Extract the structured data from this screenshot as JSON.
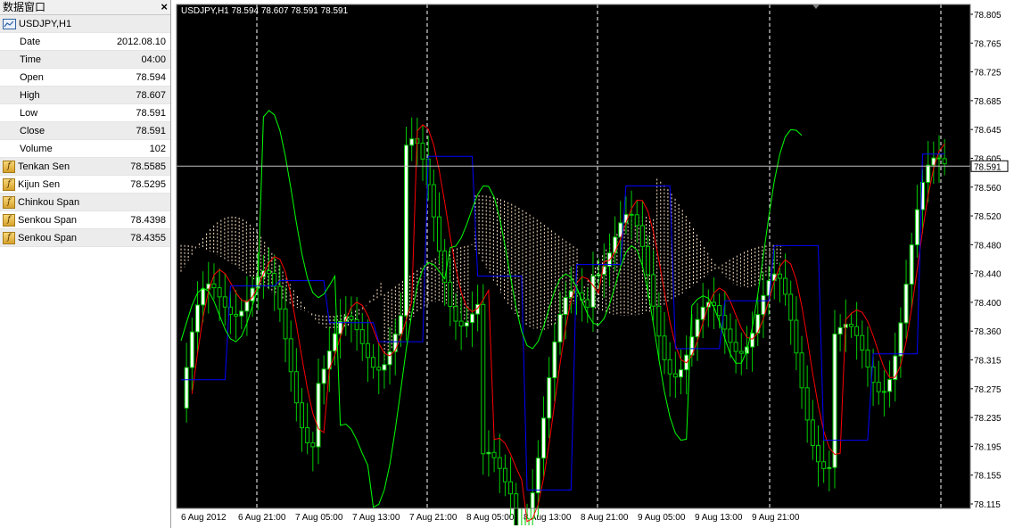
{
  "data_window": {
    "title": "数据窗口",
    "symbol": "USDJPY,H1",
    "rows": [
      {
        "label": "Date",
        "value": "2012.08.10",
        "indicator": false
      },
      {
        "label": "Time",
        "value": "04:00",
        "indicator": false
      },
      {
        "label": "Open",
        "value": "78.594",
        "indicator": false
      },
      {
        "label": "High",
        "value": "78.607",
        "indicator": false
      },
      {
        "label": "Low",
        "value": "78.591",
        "indicator": false
      },
      {
        "label": "Close",
        "value": "78.591",
        "indicator": false
      },
      {
        "label": "Volume",
        "value": "102",
        "indicator": false
      },
      {
        "label": "Tenkan Sen",
        "value": "78.5585",
        "indicator": true
      },
      {
        "label": "Kijun Sen",
        "value": "78.5295",
        "indicator": true
      },
      {
        "label": "Chinkou Span",
        "value": "",
        "indicator": true
      },
      {
        "label": "Senkou Span",
        "value": "78.4398",
        "indicator": true
      },
      {
        "label": "Senkou Span",
        "value": "78.4355",
        "indicator": true
      }
    ]
  },
  "chart": {
    "header": "USDJPY,H1  78.594 78.607 78.591 78.591",
    "current_price": "78.591",
    "price_axis": [
      "78.805",
      "78.765",
      "78.725",
      "78.685",
      "78.645",
      "78.605",
      "78.560",
      "78.520",
      "78.480",
      "78.440",
      "78.400",
      "78.360",
      "78.315",
      "78.275",
      "78.235",
      "78.195",
      "78.155",
      "78.115"
    ],
    "time_axis": [
      "6 Aug 2012",
      "6 Aug 21:00",
      "7 Aug 05:00",
      "7 Aug 13:00",
      "7 Aug 21:00",
      "8 Aug 05:00",
      "8 Aug 13:00",
      "8 Aug 21:00",
      "9 Aug 05:00",
      "9 Aug 13:00",
      "9 Aug 21:00"
    ],
    "colors": {
      "background": "#000000",
      "bull": "#ffffff",
      "bear": "#000000",
      "wick": "#00cc00",
      "tenkan": "#ff0000",
      "kijun": "#0000ff",
      "chinkou": "#00ff00",
      "cloud": "#ffe4c4",
      "grid": "#ffffff"
    }
  }
}
